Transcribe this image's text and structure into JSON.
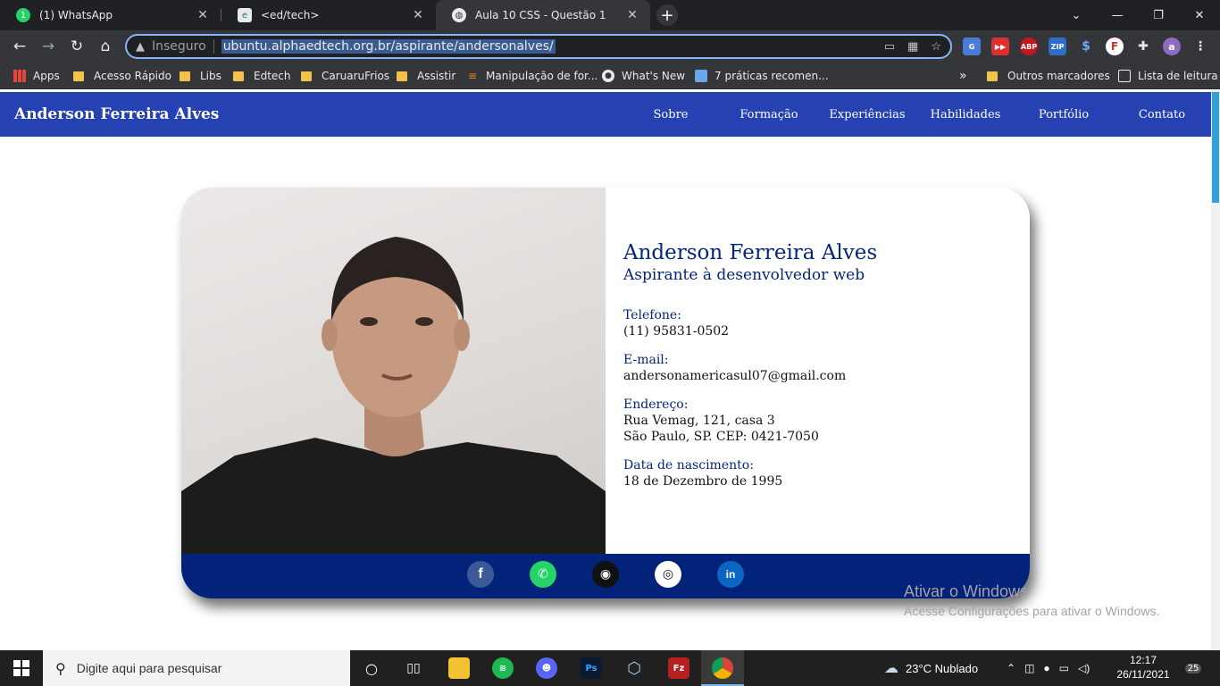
{
  "tabs": [
    {
      "title": "(1) WhatsApp",
      "close": "✕"
    },
    {
      "title": "<ed/tech>",
      "close": "✕"
    },
    {
      "title": "Aula 10 CSS - Questão 1",
      "close": "✕"
    }
  ],
  "window_controls": {
    "menu": "⌄",
    "minimize": "—",
    "restore": "❐",
    "close": "✕"
  },
  "toolbar": {
    "back": "←",
    "forward": "→",
    "reload": "↻",
    "home": "⌂",
    "security_label": "Inseguro",
    "url": "ubuntu.alphaedtech.org.br/aspirante/andersonalves/"
  },
  "bookmarks": [
    "Apps",
    "Acesso Rápido",
    "Libs",
    "Edtech",
    "CaruaruFrios",
    "Assistir",
    "Manipulação de for...",
    "What's New",
    "7 práticas recomen..."
  ],
  "bookmarks_overflow": "»",
  "bookmarks_right": [
    "Outros marcadores",
    "Lista de leitura"
  ],
  "site": {
    "brand": "Anderson Ferreira Alves",
    "nav": [
      "Sobre",
      "Formação",
      "Experiências",
      "Habilidades",
      "Portfólio",
      "Contato"
    ]
  },
  "profile": {
    "name": "Anderson Ferreira Alves",
    "role": "Aspirante à desenvolvedor web",
    "phone_label": "Telefone:",
    "phone": "(11) 95831-0502",
    "email_label": "E-mail:",
    "email": "andersonamericasul07@gmail.com",
    "address_label": "Endereço:",
    "address_line1": "Rua Vemag, 121, casa 3",
    "address_line2": "São Paulo, SP. CEP: 0421-7050",
    "birth_label": "Data de nascimento:",
    "birth": "18 de Dezembro de 1995"
  },
  "social": [
    "facebook",
    "whatsapp",
    "github",
    "instagram",
    "linkedin"
  ],
  "watermark": {
    "line1": "Ativar o Windows",
    "line2": "Acesse Configurações para ativar o Windows."
  },
  "taskbar": {
    "search_placeholder": "Digite aqui para pesquisar",
    "weather": "23°C  Nublado",
    "time": "12:17",
    "date": "26/11/2021",
    "notifications": "25"
  },
  "colors": {
    "nav_bg": "#2541b2",
    "card_footer": "#03237a",
    "text_blue": "#06257a",
    "omnibox_focus": "#8ab4f8"
  }
}
